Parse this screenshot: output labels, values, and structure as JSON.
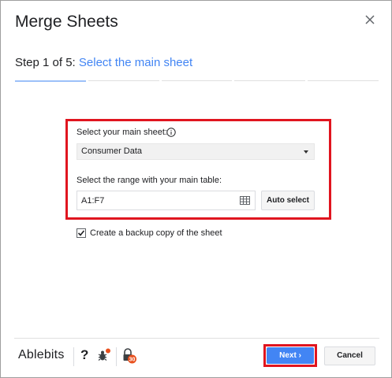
{
  "dialog": {
    "title": "Merge Sheets"
  },
  "step": {
    "counter": "Step 1 of 5:",
    "title": "Select the main sheet",
    "total": 5,
    "current": 1
  },
  "main_sheet": {
    "label": "Select your main sheet:",
    "selected": "Consumer Data"
  },
  "range": {
    "label": "Select the range with your main table:",
    "value": "A1:F7",
    "auto_select_label": "Auto select"
  },
  "backup": {
    "label": "Create a backup copy of the sheet",
    "checked": true
  },
  "footer": {
    "brand": "Ablebits",
    "help": "?",
    "next_label": "Next",
    "cancel_label": "Cancel",
    "aging_badge": "30"
  },
  "colors": {
    "accent": "#4285f4",
    "highlight": "#e0151f"
  }
}
